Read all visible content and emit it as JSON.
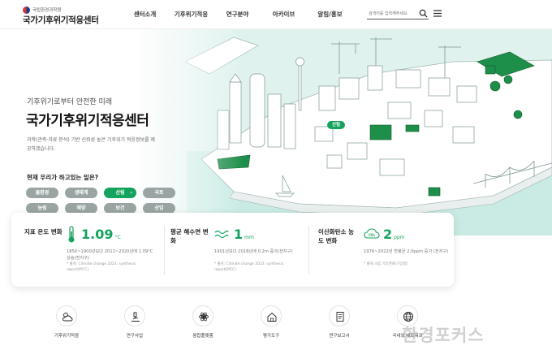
{
  "header": {
    "org_name": "국립환경과학원",
    "site_name": "국가기후위기적응센터",
    "nav": [
      "센터소개",
      "기후위기적응",
      "연구분야",
      "아카이브",
      "알림/홍보"
    ],
    "search_placeholder": "검색어를 입력해주세요."
  },
  "hero": {
    "subtitle": "기후위기로부터 안전한 미래",
    "title": "국가기후위기적응센터",
    "desc": "과학(관측·자료·분석) 기반 신뢰성 높은 기후위기 적응정보를 제공하겠습니다.",
    "question": "현재 우리가 하고있는 일은?",
    "categories": [
      "물환경",
      "생태계",
      "산림",
      "국토",
      "농림",
      "해양",
      "보건",
      "산업"
    ],
    "active_category": "산림",
    "map_tag": "산림"
  },
  "indicators": [
    {
      "label": "지표 온도 변화",
      "value": "1.09",
      "unit": "°C",
      "desc": "1850~1900년보다 2011~2020년에 1.09°C 상승(전지구)",
      "source": "* 출처: Climate change 2023: synthesis report(IPCC)"
    },
    {
      "label": "평균 해수면 변화",
      "value": "1",
      "unit": "mm",
      "desc": "1901년보다 2018년에 0.2m 증가(전지구)",
      "source": "* 출처: Climate change 2023: synthesis report(IPCC)"
    },
    {
      "label": "이산화탄소 농도 변화",
      "value": "2",
      "unit": "ppm",
      "desc": "1976~2022년 연평균 2.0ppm 증가 (전지구)",
      "source": "* 출처:국립 기후변화(기상청)"
    }
  ],
  "quick_menu": [
    "기후위기적응",
    "연구사업",
    "융합플랫폼",
    "평가도구",
    "연구보고서",
    "국내외 네트워크"
  ],
  "watermark": "환경포커스",
  "colors": {
    "accent": "#14a35c",
    "hero_bg": "#dff2ee",
    "chip_gray": "#9aa5a3"
  }
}
